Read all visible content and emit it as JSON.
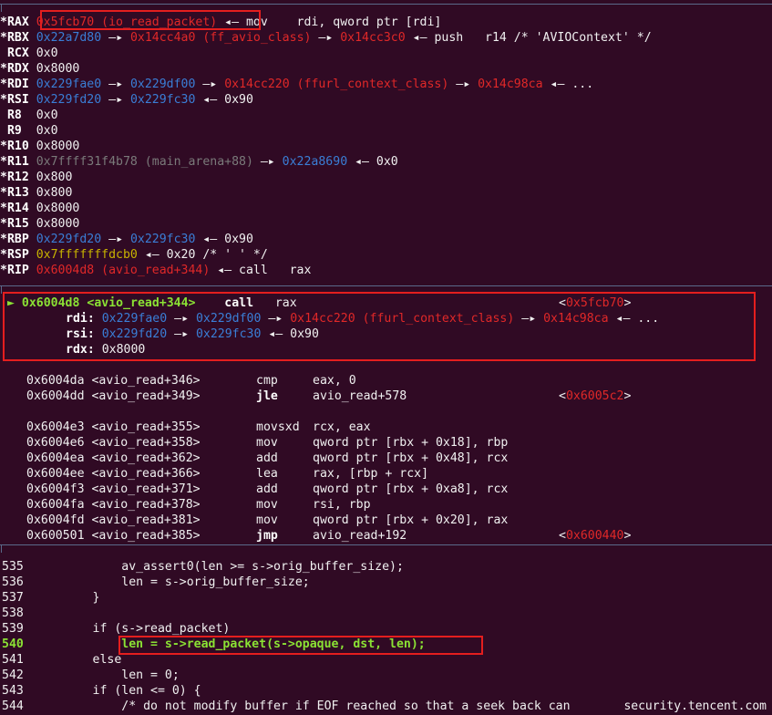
{
  "registers": [
    {
      "name": "*RAX",
      "parts": [
        [
          "rd",
          "0x5fcb70 (io_read_packet)"
        ],
        [
          "w",
          " ◂— mov    rdi, qword ptr [rdi]"
        ]
      ]
    },
    {
      "name": "*RBX",
      "parts": [
        [
          "bl",
          "0x22a7d80"
        ],
        [
          "w",
          " —▸ "
        ],
        [
          "rd",
          "0x14cc4a0 (ff_avio_class)"
        ],
        [
          "w",
          " —▸ "
        ],
        [
          "rd",
          "0x14cc3c0"
        ],
        [
          "w",
          " ◂— push   r14 /* 'AVIOContext' */"
        ]
      ]
    },
    {
      "name": " RCX",
      "parts": [
        [
          "w",
          "0x0"
        ]
      ]
    },
    {
      "name": "*RDX",
      "parts": [
        [
          "w",
          "0x8000"
        ]
      ]
    },
    {
      "name": "*RDI",
      "parts": [
        [
          "bl",
          "0x229fae0"
        ],
        [
          "w",
          " —▸ "
        ],
        [
          "bl",
          "0x229df00"
        ],
        [
          "w",
          " —▸ "
        ],
        [
          "rd",
          "0x14cc220 (ffurl_context_class)"
        ],
        [
          "w",
          " —▸ "
        ],
        [
          "rd",
          "0x14c98ca"
        ],
        [
          "w",
          " ◂— ..."
        ]
      ]
    },
    {
      "name": "*RSI",
      "parts": [
        [
          "bl",
          "0x229fd20"
        ],
        [
          "w",
          " —▸ "
        ],
        [
          "bl",
          "0x229fc30"
        ],
        [
          "w",
          " ◂— 0x90"
        ]
      ]
    },
    {
      "name": " R8 ",
      "parts": [
        [
          "w",
          "0x0"
        ]
      ]
    },
    {
      "name": " R9 ",
      "parts": [
        [
          "w",
          "0x0"
        ]
      ]
    },
    {
      "name": "*R10",
      "parts": [
        [
          "w",
          "0x8000"
        ]
      ]
    },
    {
      "name": "*R11",
      "parts": [
        [
          "gr",
          "0x7ffff31f4b78 (main_arena+88)"
        ],
        [
          "w",
          " —▸ "
        ],
        [
          "bl",
          "0x22a8690"
        ],
        [
          "w",
          " ◂— 0x0"
        ]
      ]
    },
    {
      "name": "*R12",
      "parts": [
        [
          "w",
          "0x800"
        ]
      ]
    },
    {
      "name": "*R13",
      "parts": [
        [
          "w",
          "0x800"
        ]
      ]
    },
    {
      "name": "*R14",
      "parts": [
        [
          "w",
          "0x8000"
        ]
      ]
    },
    {
      "name": "*R15",
      "parts": [
        [
          "w",
          "0x8000"
        ]
      ]
    },
    {
      "name": "*RBP",
      "parts": [
        [
          "bl",
          "0x229fd20"
        ],
        [
          "w",
          " —▸ "
        ],
        [
          "bl",
          "0x229fc30"
        ],
        [
          "w",
          " ◂— 0x90"
        ]
      ]
    },
    {
      "name": "*RSP",
      "parts": [
        [
          "ye",
          "0x7fffffffdcb0"
        ],
        [
          "w",
          " ◂— 0x20 /* ' ' */"
        ]
      ]
    },
    {
      "name": "*RIP",
      "parts": [
        [
          "rd",
          "0x6004d8 (avio_read+344)"
        ],
        [
          "w",
          " ◂— call   rax"
        ]
      ]
    }
  ],
  "current_instruction": {
    "marker": "►",
    "addr": "0x6004d8",
    "sym": "<avio_read+344>",
    "op": "call",
    "args": "rax",
    "target_open": "<",
    "target": "0x5fcb70",
    "target_close": ">"
  },
  "call_args": [
    {
      "label": "rdi:",
      "parts": [
        [
          "bl",
          "0x229fae0"
        ],
        [
          "w",
          " —▸ "
        ],
        [
          "bl",
          "0x229df00"
        ],
        [
          "w",
          " —▸ "
        ],
        [
          "rd",
          "0x14cc220 (ffurl_context_class)"
        ],
        [
          "w",
          " —▸ "
        ],
        [
          "rd",
          "0x14c98ca"
        ],
        [
          "w",
          " ◂— ..."
        ]
      ]
    },
    {
      "label": "rsi:",
      "parts": [
        [
          "bl",
          "0x229fd20"
        ],
        [
          "w",
          " —▸ "
        ],
        [
          "bl",
          "0x229fc30"
        ],
        [
          "w",
          " ◂— 0x90"
        ]
      ]
    },
    {
      "label": "rdx:",
      "parts": [
        [
          "w",
          "0x8000"
        ]
      ]
    }
  ],
  "disasm": [
    {
      "addr": "0x6004da",
      "sym": "<avio_read+346>",
      "op": "cmp",
      "args": "eax, 0",
      "target": "",
      "bold": false
    },
    {
      "addr": "0x6004dd",
      "sym": "<avio_read+349>",
      "op": "jle",
      "args": "avio_read+578",
      "target": "0x6005c2",
      "bold": true
    },
    {
      "addr": "",
      "sym": "",
      "op": "",
      "args": "",
      "target": "",
      "bold": false
    },
    {
      "addr": "0x6004e3",
      "sym": "<avio_read+355>",
      "op": "movsxd",
      "args": "rcx, eax",
      "target": "",
      "bold": false
    },
    {
      "addr": "0x6004e6",
      "sym": "<avio_read+358>",
      "op": "mov",
      "args": "qword ptr [rbx + 0x18], rbp",
      "target": "",
      "bold": false
    },
    {
      "addr": "0x6004ea",
      "sym": "<avio_read+362>",
      "op": "add",
      "args": "qword ptr [rbx + 0x48], rcx",
      "target": "",
      "bold": false
    },
    {
      "addr": "0x6004ee",
      "sym": "<avio_read+366>",
      "op": "lea",
      "args": "rax, [rbp + rcx]",
      "target": "",
      "bold": false
    },
    {
      "addr": "0x6004f3",
      "sym": "<avio_read+371>",
      "op": "add",
      "args": "qword ptr [rbx + 0xa8], rcx",
      "target": "",
      "bold": false
    },
    {
      "addr": "0x6004fa",
      "sym": "<avio_read+378>",
      "op": "mov",
      "args": "rsi, rbp",
      "target": "",
      "bold": false
    },
    {
      "addr": "0x6004fd",
      "sym": "<avio_read+381>",
      "op": "mov",
      "args": "qword ptr [rbx + 0x20], rax",
      "target": "",
      "bold": false
    },
    {
      "addr": "0x600501",
      "sym": "<avio_read+385>",
      "op": "jmp",
      "args": "avio_read+192",
      "target": "0x600440",
      "bold": true
    }
  ],
  "source": [
    {
      "num": "535",
      "code": "            av_assert0(len >= s->orig_buffer_size);",
      "current": false
    },
    {
      "num": "536",
      "code": "            len = s->orig_buffer_size;",
      "current": false
    },
    {
      "num": "537",
      "code": "        }",
      "current": false
    },
    {
      "num": "538",
      "code": "",
      "current": false
    },
    {
      "num": "539",
      "code": "        if (s->read_packet)",
      "current": false
    },
    {
      "num": "540",
      "code": "            len = s->read_packet(s->opaque, dst, len);",
      "current": true
    },
    {
      "num": "541",
      "code": "        else",
      "current": false
    },
    {
      "num": "542",
      "code": "            len = 0;",
      "current": false
    },
    {
      "num": "543",
      "code": "        if (len <= 0) {",
      "current": false
    },
    {
      "num": "544",
      "code": "            /* do not modify buffer if EOF reached so that a seek back can",
      "current": false
    }
  ],
  "watermark": "security.tencent.com"
}
